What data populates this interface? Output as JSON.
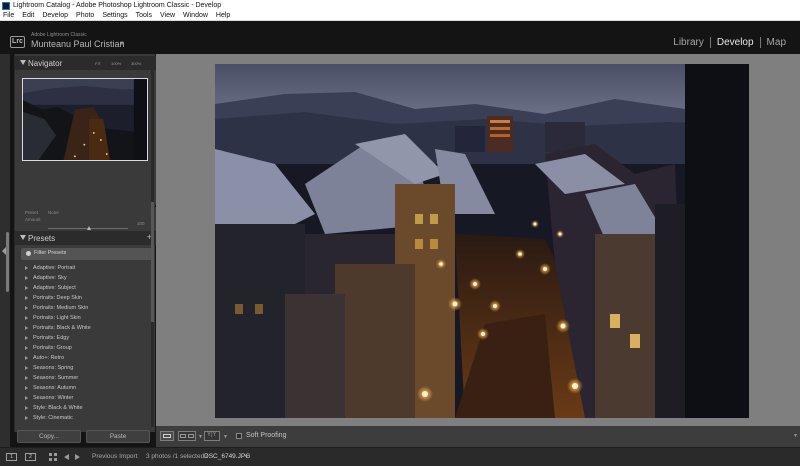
{
  "window": {
    "title": "Lightroom Catalog - Adobe Photoshop Lightroom Classic - Develop"
  },
  "menu": [
    "File",
    "Edit",
    "Develop",
    "Photo",
    "Settings",
    "Tools",
    "View",
    "Window",
    "Help"
  ],
  "identity": {
    "logo": "Lrc",
    "product": "Adobe Lightroom Classic",
    "user": "Munteanu Paul Cristian",
    "caret": "▼"
  },
  "modules": {
    "library": "Library",
    "develop": "Develop",
    "map": "Map"
  },
  "navigator": {
    "title": "Navigator",
    "zoom_fit": "FIT",
    "zoom_100": "100%",
    "zoom_300": "300%"
  },
  "basic": {
    "preset_label": "Preset",
    "preset_value": "None",
    "amount_label": "Amount",
    "amount_value": "100"
  },
  "presets": {
    "title": "Presets",
    "add": "+",
    "filter_placeholder": "Filter Presets",
    "items": [
      "Adaptive: Portrait",
      "Adaptive: Sky",
      "Adaptive: Subject",
      "Portraits: Deep Skin",
      "Portraits: Medium Skin",
      "Portraits: Light Skin",
      "Portraits: Black & White",
      "Portraits: Edgy",
      "Portraits: Group",
      "Auto+: Retro",
      "Seasons: Spring",
      "Seasons: Summer",
      "Seasons: Autumn",
      "Seasons: Winter",
      "Style: Black & White",
      "Style: Cinematic"
    ]
  },
  "buttons": {
    "copy": "Copy...",
    "paste": "Paste"
  },
  "toolbar": {
    "soft_proofing": "Soft Proofing"
  },
  "filmstrip": {
    "mon1": "1",
    "mon2": "2",
    "source": "Previous Import",
    "count": "3 photos /1 selected /",
    "filename": "DSC_6749.JPG",
    "caret": "▼"
  },
  "colors": {
    "panel": "#3a3a3a",
    "background": "#141414",
    "canvas": "#7f7f7f",
    "accent_active": "#e6e6e6"
  },
  "icons": [
    "lightroom-app-icon",
    "collapse-triangle-icon",
    "add-icon",
    "filter-icon",
    "loupe-view-icon",
    "compare-view-icon",
    "before-after-icon",
    "grid-icon",
    "prev-arrow-icon",
    "next-arrow-icon"
  ]
}
